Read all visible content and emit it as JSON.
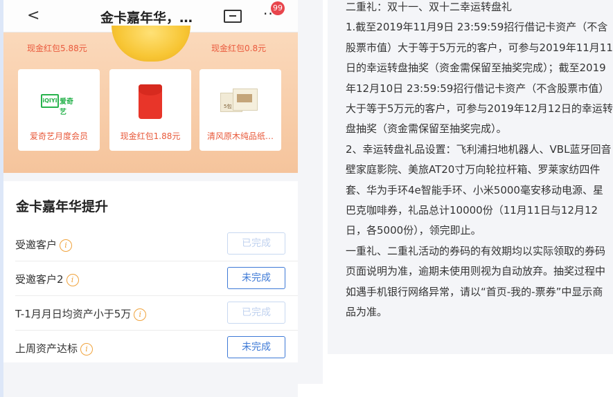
{
  "nav": {
    "back_glyph": "<",
    "title": "金卡嘉年华，…",
    "more_glyph": "···",
    "badge_count": "99"
  },
  "prizes": {
    "top_left_label": "现金红包5.88元",
    "top_right_label": "现金红包0.8元",
    "cards": [
      {
        "label": "爱奇艺月度会员",
        "icon": "iqiyi-logo"
      },
      {
        "label": "现金红包1.88元",
        "icon": "red-packet-icon"
      },
      {
        "label": "清风原木纯品纸…",
        "icon": "tissue-pack-icon"
      }
    ],
    "iqiyi_logo_text": "爱奇艺",
    "iqiyi_box_text": "iQIYI"
  },
  "promotion": {
    "heading": "金卡嘉年华提升",
    "tasks": [
      {
        "name": "受邀客户",
        "status": "已完成"
      },
      {
        "name": "受邀客户2",
        "status": "未完成"
      },
      {
        "name": "T-1月月日均资产小于5万",
        "status": "已完成"
      },
      {
        "name": "上周资产达标",
        "status": "未完成"
      }
    ],
    "info_glyph": "i"
  },
  "rules": {
    "paragraphs": [
      "二重礼：双十一、双十二幸运转盘礼",
      "1.截至2019年11月9日 23:59:59招行借记卡资产（不含股票市值）大于等于5万元的客户，可参与2019年11月11日的幸运转盘抽奖（资金需保留至抽奖完成）；截至2019年12月10日 23:59:59招行借记卡资产（不含股票市值）大于等于5万元的客户，可参与2019年12月12日的幸运转盘抽奖（资金需保留至抽奖完成）。",
      "2、幸运转盘礼品设置：飞利浦扫地机器人、VBL蓝牙回音壁家庭影院、美旅AT20寸万向轮拉杆箱、罗莱家纺四件套、华为手环4e智能手环、小米5000毫安移动电源、星巴克咖啡券，礼品总计10000份（11月11日与12月12日，各5000份），领完即止。",
      "一重礼、二重礼活动的券码的有效期均以实际领取的券码页面说明为准，逾期未使用则视为自动放弃。抽奖过程中如遇手机银行网络异常，请以“首页-我的-票券”中显示商品为准。"
    ]
  }
}
